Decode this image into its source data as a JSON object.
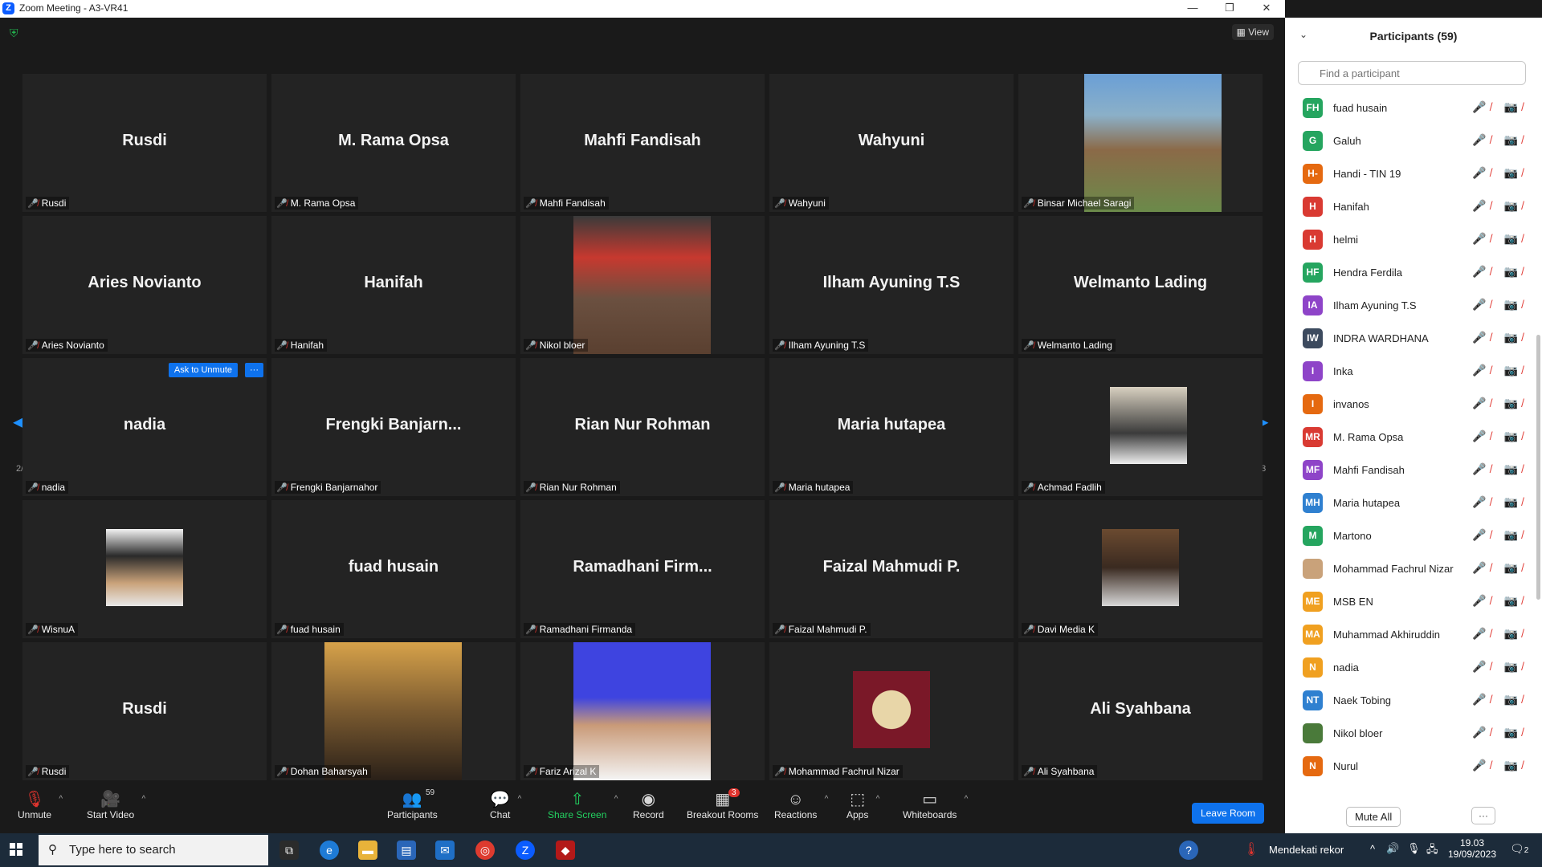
{
  "window": {
    "title": "Zoom Meeting - A3-VR41"
  },
  "meeting": {
    "view_label": "View",
    "page_indicator": "2/3",
    "ask_to_unmute_label": "Ask to Unmute",
    "more_label": "···",
    "tiles": [
      {
        "big": "Rusdi",
        "label": "Rusdi"
      },
      {
        "big": "M. Rama Opsa",
        "label": "M. Rama Opsa"
      },
      {
        "big": "Mahfi Fandisah",
        "label": "Mahfi Fandisah"
      },
      {
        "big": "Wahyuni",
        "label": "Wahyuni"
      },
      {
        "big": "",
        "label": "Binsar Michael Saragi"
      },
      {
        "big": "Aries Novianto",
        "label": "Aries Novianto"
      },
      {
        "big": "Hanifah",
        "label": "Hanifah"
      },
      {
        "big": "",
        "label": "Nikol bloer"
      },
      {
        "big": "Ilham Ayuning T.S",
        "label": "Ilham Ayuning T.S"
      },
      {
        "big": "Welmanto Lading",
        "label": "Welmanto Lading"
      },
      {
        "big": "nadia",
        "label": "nadia"
      },
      {
        "big": "Frengki  Banjarn...",
        "label": "Frengki Banjarnahor"
      },
      {
        "big": "Rian Nur Rohman",
        "label": "Rian Nur Rohman"
      },
      {
        "big": "Maria hutapea",
        "label": "Maria hutapea"
      },
      {
        "big": "",
        "label": "Achmad Fadlih"
      },
      {
        "big": "",
        "label": "WisnuA"
      },
      {
        "big": "fuad husain",
        "label": "fuad husain"
      },
      {
        "big": "Ramadhani  Firm...",
        "label": "Ramadhani Firmanda"
      },
      {
        "big": "Faizal Mahmudi P.",
        "label": "Faizal Mahmudi P."
      },
      {
        "big": "",
        "label": "Davi Media K"
      },
      {
        "big": "Rusdi",
        "label": "Rusdi"
      },
      {
        "big": "",
        "label": "Dohan Baharsyah"
      },
      {
        "big": "",
        "label": "Fariz Arizal K"
      },
      {
        "big": "",
        "label": "Mohammad Fachrul Nizar"
      },
      {
        "big": "Ali Syahbana",
        "label": "Ali Syahbana"
      }
    ]
  },
  "toolbar": {
    "unmute": "Unmute",
    "start_video": "Start Video",
    "participants": "Participants",
    "participants_count": "59",
    "chat": "Chat",
    "share_screen": "Share Screen",
    "record": "Record",
    "breakout_rooms": "Breakout Rooms",
    "breakout_badge": "3",
    "reactions": "Reactions",
    "apps": "Apps",
    "whiteboards": "Whiteboards",
    "leave_room": "Leave Room"
  },
  "participants_panel": {
    "title": "Participants (59)",
    "search_placeholder": "Find a participant",
    "mute_all": "Mute All",
    "more": "···",
    "items": [
      {
        "initials": "FH",
        "color": "#25a55f",
        "name": "fuad husain"
      },
      {
        "initials": "G",
        "color": "#25a55f",
        "name": "Galuh"
      },
      {
        "initials": "H-",
        "color": "#e56910",
        "name": "Handi - TIN 19"
      },
      {
        "initials": "H",
        "color": "#d93a32",
        "name": "Hanifah"
      },
      {
        "initials": "H",
        "color": "#d93a32",
        "name": "helmi"
      },
      {
        "initials": "HF",
        "color": "#25a55f",
        "name": "Hendra Ferdila"
      },
      {
        "initials": "IA",
        "color": "#8e44c8",
        "name": "Ilham Ayuning T.S"
      },
      {
        "initials": "IW",
        "color": "#3c4a5e",
        "name": "INDRA WARDHANA"
      },
      {
        "initials": "I",
        "color": "#8e44c8",
        "name": "Inka"
      },
      {
        "initials": "I",
        "color": "#e56910",
        "name": "invanos"
      },
      {
        "initials": "MR",
        "color": "#d93a32",
        "name": "M. Rama Opsa"
      },
      {
        "initials": "MF",
        "color": "#8e44c8",
        "name": "Mahfi Fandisah"
      },
      {
        "initials": "MH",
        "color": "#2f80d0",
        "name": "Maria hutapea"
      },
      {
        "initials": "M",
        "color": "#25a55f",
        "name": "Martono"
      },
      {
        "initials": "",
        "color": "#c9a27a",
        "name": "Mohammad Fachrul Nizar"
      },
      {
        "initials": "ME",
        "color": "#f0a020",
        "name": "MSB EN"
      },
      {
        "initials": "MA",
        "color": "#f0a020",
        "name": "Muhammad Akhiruddin"
      },
      {
        "initials": "N",
        "color": "#f0a020",
        "name": "nadia"
      },
      {
        "initials": "NT",
        "color": "#2f80d0",
        "name": "Naek Tobing"
      },
      {
        "initials": "",
        "color": "#4a7a3a",
        "name": "Nikol bloer"
      },
      {
        "initials": "N",
        "color": "#e56910",
        "name": "Nurul"
      }
    ]
  },
  "taskbar": {
    "search_placeholder": "Type here to search",
    "weather": "Mendekati rekor",
    "time": "19.03",
    "date": "19/09/2023",
    "notification_count": "2"
  }
}
